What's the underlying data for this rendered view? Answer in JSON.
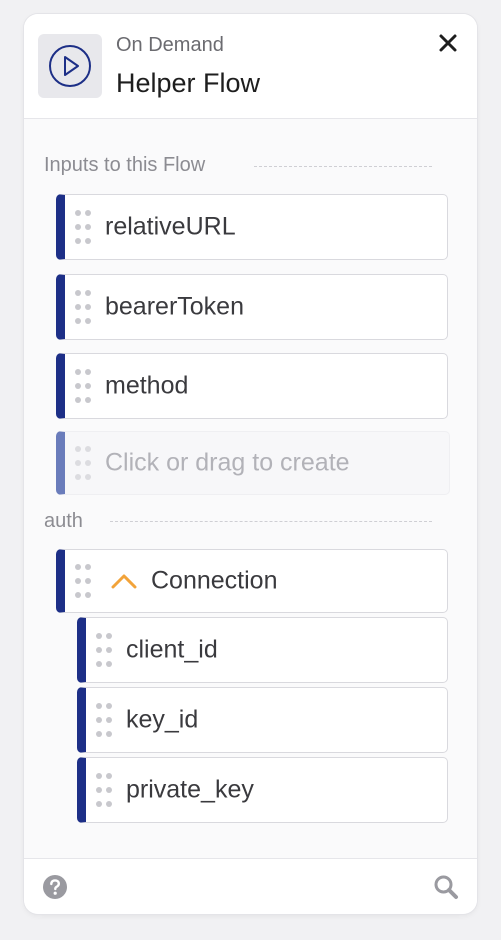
{
  "header": {
    "subtitle": "On Demand",
    "title": "Helper Flow"
  },
  "inputs_section": {
    "label": "Inputs to this Flow",
    "items": [
      {
        "label": "relativeURL"
      },
      {
        "label": "bearerToken"
      },
      {
        "label": "method"
      }
    ],
    "placeholder": "Click or drag to create"
  },
  "auth_section": {
    "label": "auth",
    "group": {
      "label": "Connection",
      "expanded": true,
      "children": [
        {
          "label": "client_id"
        },
        {
          "label": "key_id"
        },
        {
          "label": "private_key"
        }
      ]
    }
  },
  "colors": {
    "accent": "#1d2f87",
    "placeholder_accent": "#6a7cbb",
    "chevron": "#f2a33a",
    "icon_gray": "#9a9aa0"
  },
  "icons": {
    "trigger": "play-circle-icon",
    "close": "close-icon",
    "help": "help-circle-icon",
    "search": "search-icon",
    "grip": "drag-handle-icon",
    "expand": "chevron-up-icon"
  }
}
